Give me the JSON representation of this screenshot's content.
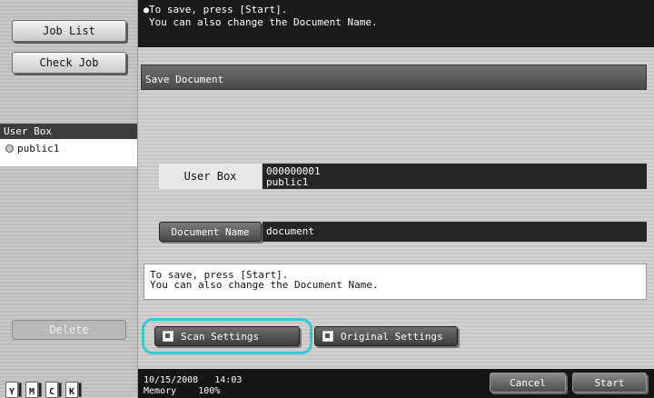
{
  "sidebar": {
    "job_list": "Job List",
    "check_job": "Check Job",
    "user_box_header": "User Box",
    "user_box_item": "public1",
    "delete": "Delete",
    "toners": [
      "Y",
      "M",
      "C",
      "K"
    ]
  },
  "message": {
    "line1": "To save, press [Start].",
    "line2": "You can also change the Document Name."
  },
  "main": {
    "title": "Save Document",
    "user_box_label": "User Box",
    "user_box_number": "000000001",
    "user_box_name": "public1",
    "document_name_button": "Document Name",
    "document_name_value": "document",
    "info_line1": "To save, press [Start].",
    "info_line2": "You can also change the Document Name.",
    "scan_settings": "Scan Settings",
    "original_settings": "Original Settings"
  },
  "status": {
    "date": "10/15/2008",
    "time": "14:03",
    "memory_label": "Memory",
    "memory_value": "100%"
  },
  "actions": {
    "cancel": "Cancel",
    "start": "Start"
  },
  "colors": {
    "highlight": "#3fc4d6",
    "dark_bar": "#1a1a1a"
  }
}
